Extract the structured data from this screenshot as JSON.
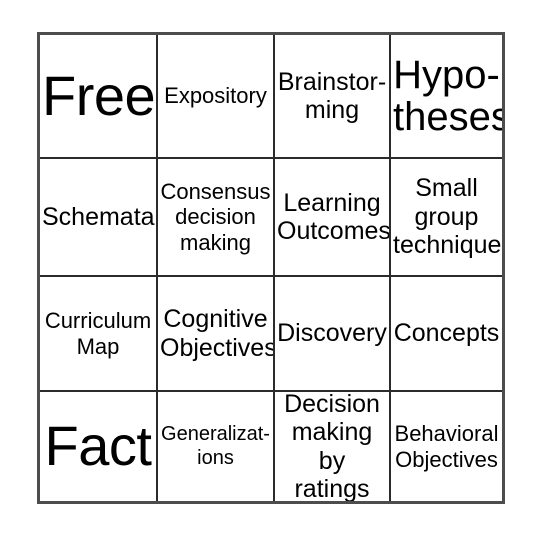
{
  "card": {
    "type": "bingo-card",
    "grid": {
      "rows": 4,
      "columns": 4
    },
    "colors": {
      "outer_border": "#4d4d4d",
      "inner_border": "#2b2b2b",
      "background": "#ffffff",
      "text": "#000000"
    },
    "cells": [
      {
        "id": "r0c0",
        "text": "Free!",
        "size": "xxl",
        "free_space": true
      },
      {
        "id": "r0c1",
        "text": "Expository",
        "size": "sm",
        "free_space": false
      },
      {
        "id": "r0c2",
        "text": "Brainstor-\nming",
        "size": "md",
        "free_space": false
      },
      {
        "id": "r0c3",
        "text": "Hypo-\ntheses",
        "size": "xl",
        "free_space": false
      },
      {
        "id": "r1c0",
        "text": "Schemata",
        "size": "md",
        "free_space": false
      },
      {
        "id": "r1c1",
        "text": "Consensus\ndecision\nmaking",
        "size": "sm",
        "free_space": false
      },
      {
        "id": "r1c2",
        "text": "Learning\nOutcomes",
        "size": "md",
        "free_space": false
      },
      {
        "id": "r1c3",
        "text": "Small\ngroup\ntechnique",
        "size": "md",
        "free_space": false
      },
      {
        "id": "r2c0",
        "text": "Curriculum\nMap",
        "size": "sm",
        "free_space": false
      },
      {
        "id": "r2c1",
        "text": "Cognitive\nObjectives",
        "size": "md",
        "free_space": false
      },
      {
        "id": "r2c2",
        "text": "Discovery",
        "size": "md",
        "free_space": false
      },
      {
        "id": "r2c3",
        "text": "Concepts",
        "size": "md",
        "free_space": false
      },
      {
        "id": "r3c0",
        "text": "Fact",
        "size": "xxl",
        "free_space": false
      },
      {
        "id": "r3c1",
        "text": "Generalizat-\nions",
        "size": "xs",
        "free_space": false
      },
      {
        "id": "r3c2",
        "text": "Decision\nmaking by\nratings",
        "size": "md",
        "free_space": false
      },
      {
        "id": "r3c3",
        "text": "Behavioral\nObjectives",
        "size": "sm",
        "free_space": false
      }
    ]
  }
}
